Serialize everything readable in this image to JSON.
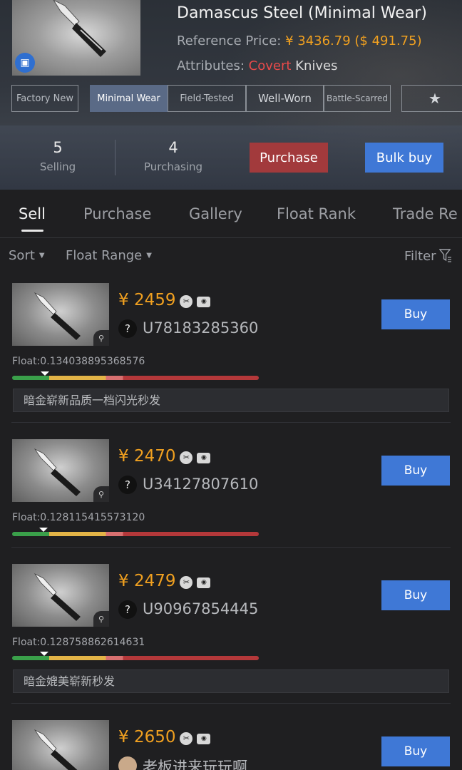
{
  "item": {
    "title": "Damascus Steel (Minimal Wear)",
    "ref_label": "Reference Price: ",
    "ref_price": "¥ 3436.79",
    "ref_usd": "($ 491.75)",
    "attr_label": "Attributes: ",
    "attr_rarity": "Covert",
    "attr_type": "Knives"
  },
  "wear_tabs": [
    {
      "label": "Factory New"
    },
    {
      "label": "Minimal Wear",
      "active": true
    },
    {
      "label": "Field-Tested"
    },
    {
      "label": "Well-Worn"
    },
    {
      "label": "Battle-Scarred"
    }
  ],
  "stats": {
    "selling_count": "5",
    "selling_label": "Selling",
    "purchasing_count": "4",
    "purchasing_label": "Purchasing"
  },
  "actions": {
    "purchase": "Purchase",
    "bulk_buy": "Bulk buy"
  },
  "tabs": [
    "Sell",
    "Purchase",
    "Gallery",
    "Float Rank",
    "Trade Re"
  ],
  "filters": {
    "sort": "Sort",
    "float_range": "Float Range",
    "filter": "Filter"
  },
  "listings": [
    {
      "price": "¥ 2459",
      "seller": "U78183285360",
      "float": "Float:0.134038895368576",
      "float_value": 0.134038895368576,
      "note": "暗金崭新品质一档闪光秒发",
      "buy": "Buy"
    },
    {
      "price": "¥ 2470",
      "seller": "U34127807610",
      "float": "Float:0.128115415573120",
      "float_value": 0.12811541557312,
      "note": "",
      "buy": "Buy"
    },
    {
      "price": "¥ 2479",
      "seller": "U90967854445",
      "float": "Float:0.128758862614631",
      "float_value": 0.128758862614631,
      "note": "暗金媲美崭新秒发",
      "buy": "Buy"
    },
    {
      "price": "¥ 2650",
      "seller": "老板进来玩玩啊",
      "float": "",
      "note": "",
      "buy": "Buy"
    }
  ]
}
